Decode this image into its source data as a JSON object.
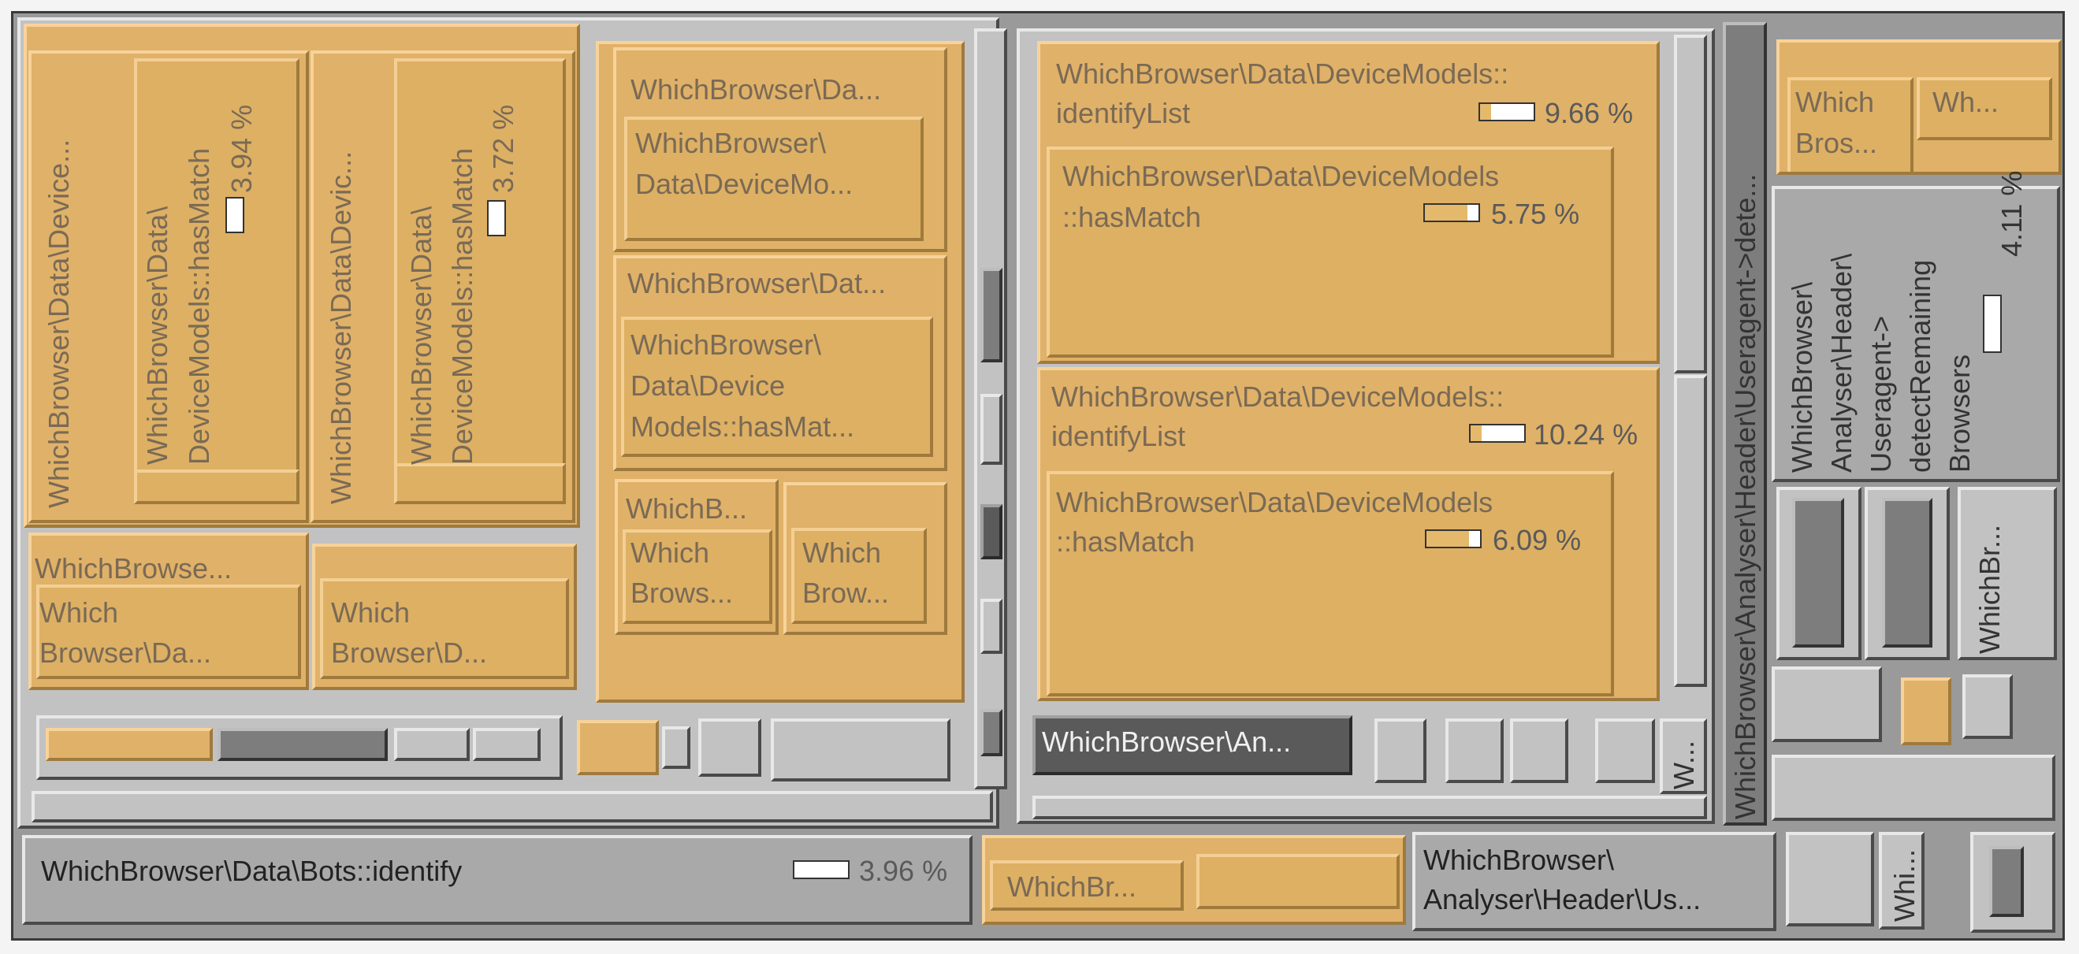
{
  "treemap": {
    "labels": {
      "vert_device_1": "WhichBrowser\\Data\\Device...",
      "vert_hasmatch_1a": "WhichBrowser\\Data\\",
      "vert_hasmatch_1b": "DeviceModels::hasMatch",
      "vert_device_2": "WhichBrowser\\Data\\Devic...",
      "vert_hasmatch_2a": "WhichBrowser\\Data\\",
      "vert_hasmatch_2b": "DeviceModels::hasMatch",
      "pct_hasmatch_1": "3.94 %",
      "pct_hasmatch_2": "3.72 %",
      "wb_da_1": "WhichBrowser\\Da...",
      "wb_data_devicemo_a": "WhichBrowser\\",
      "wb_data_devicemo_b": "Data\\DeviceMo...",
      "wb_dat_1": "WhichBrowser\\Dat...",
      "wb_dev_hasmat_a": "WhichBrowser\\",
      "wb_dev_hasmat_b": "Data\\Device",
      "wb_dev_hasmat_c": "Models::hasMat...",
      "wb_b_small": "WhichB...",
      "which_brows_a": "Which",
      "which_brows_b": "Brows...",
      "which_brow_a": "Which",
      "which_brow_b": "Brow...",
      "wb_browse_1": "WhichBrowse...",
      "which_browser_da_a": "Which",
      "which_browser_da_b": "Browser\\Da...",
      "which_browser_d_a": "Which",
      "which_browser_d_b": "Browser\\D...",
      "identify_list_1a": "WhichBrowser\\Data\\DeviceModels::",
      "identify_list_1b": "identifyList",
      "pct_identify_1": "9.66 %",
      "hasmatch_3a": "WhichBrowser\\Data\\DeviceModels",
      "hasmatch_3b": "::hasMatch",
      "pct_hasmatch_3": "5.75 %",
      "identify_list_2a": "WhichBrowser\\Data\\DeviceModels::",
      "identify_list_2b": "identifyList",
      "pct_identify_2": "10.24 %",
      "hasmatch_4a": "WhichBrowser\\Data\\DeviceModels",
      "hasmatch_4b": "::hasMatch",
      "pct_hasmatch_4": "6.09 %",
      "analyser_an": "WhichBrowser\\An...",
      "w_short": "W...",
      "vert_useragent_dete": "WhichBrowser\\Analyser\\Header\\Useragent->dete...",
      "which_bros_a": "Which",
      "which_bros_b": "Bros...",
      "wh_short": "Wh...",
      "detect_rem_1": "WhichBrowser\\",
      "detect_rem_2": "Analyser\\Header\\",
      "detect_rem_3": "Useragent->",
      "detect_rem_4": "detectRemaining",
      "detect_rem_5": "Browsers",
      "pct_detect_rem": "4.11 %",
      "vert_whichbr": "WhichBr...",
      "bots_identify": "WhichBrowser\\Data\\Bots::identify",
      "pct_bots": "3.96 %",
      "whichbr_bottom": "WhichBr...",
      "analyser_header_us_a": "WhichBrowser\\",
      "analyser_header_us_b": "Analyser\\Header\\Us...",
      "vert_whi": "Whi..."
    },
    "values_percent": {
      "hasmatch_1": 3.94,
      "hasmatch_2": 3.72,
      "identify_1": 9.66,
      "hasmatch_3": 5.75,
      "identify_2": 10.24,
      "hasmatch_4": 6.09,
      "detect_rem": 4.11,
      "bots": 3.96
    },
    "colors": {
      "highlight": "#e0b168",
      "frame": "#3a3a3a",
      "cell": "#a9a9a9",
      "dark_cell": "#5a5a5a"
    }
  }
}
